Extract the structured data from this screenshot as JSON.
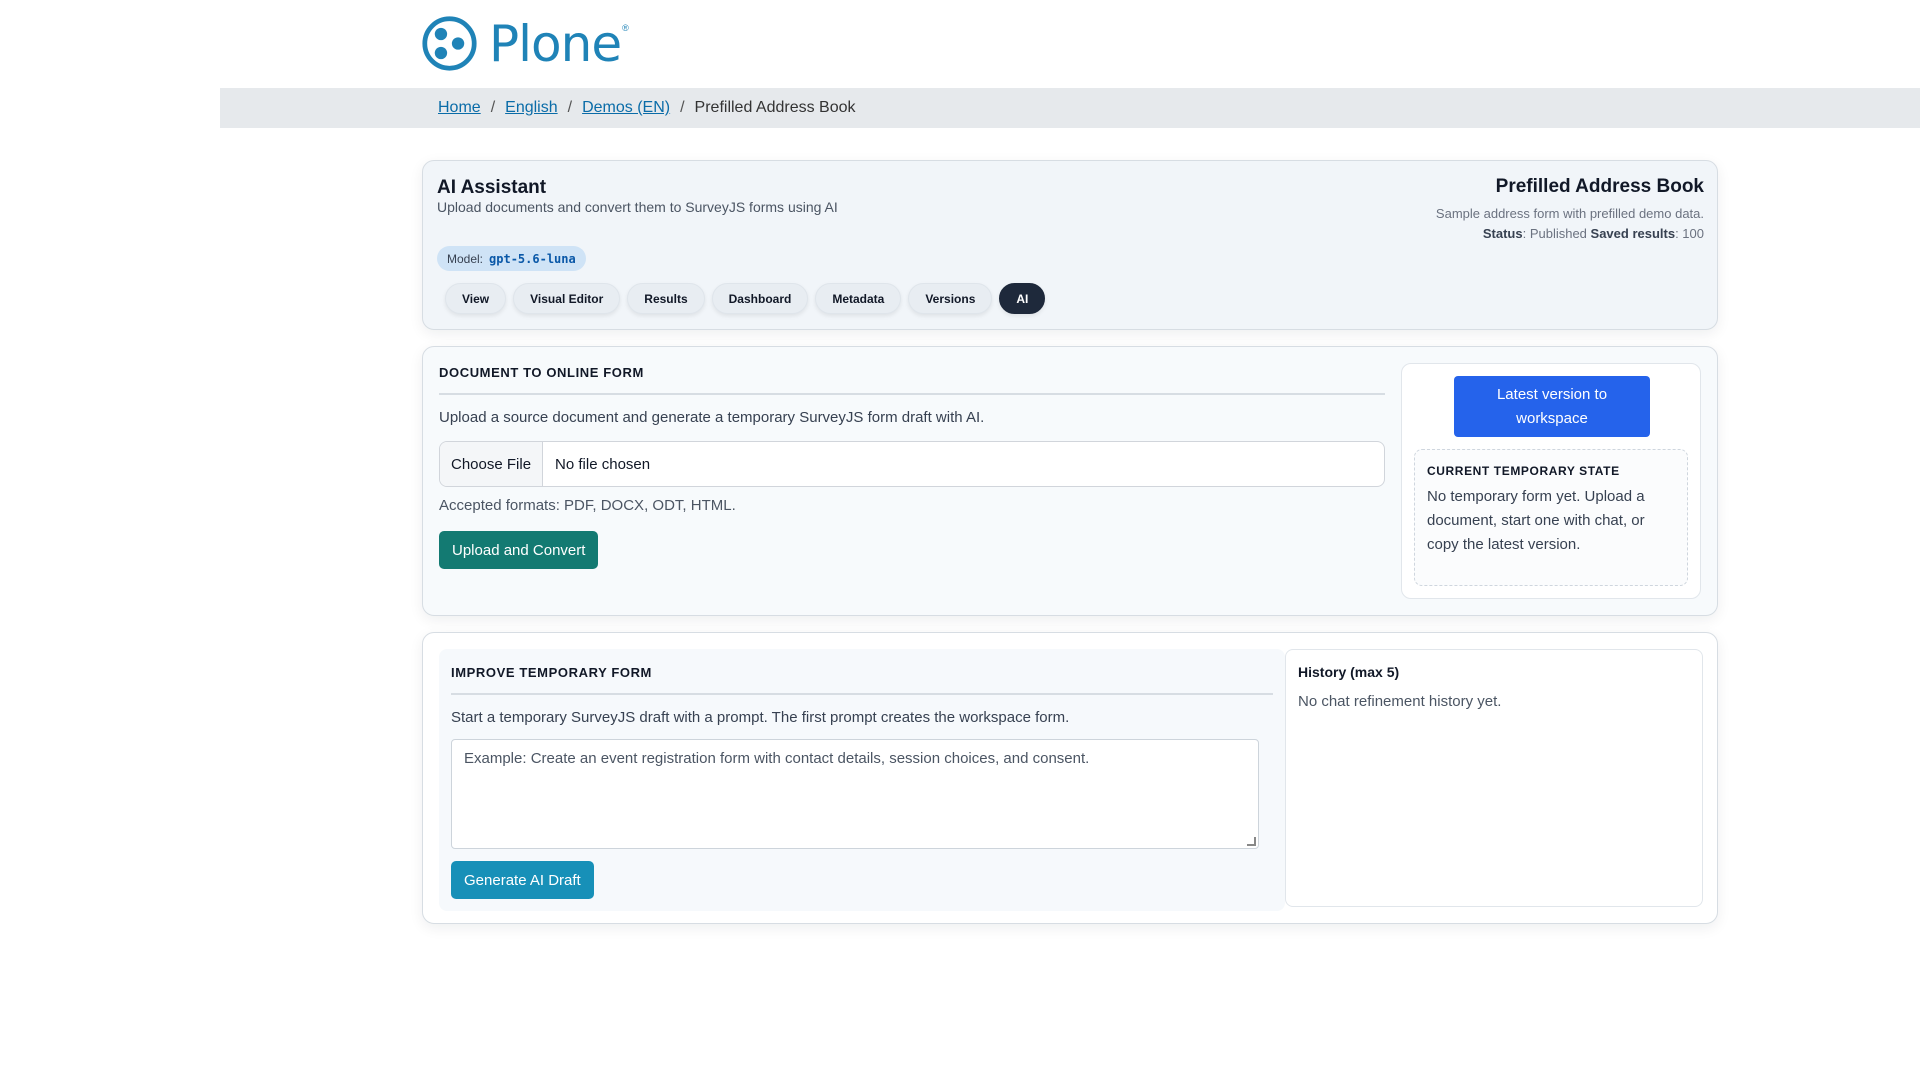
{
  "brand": {
    "name": "Plone",
    "reg": "®",
    "color": "#1f83b7"
  },
  "breadcrumb": {
    "items": [
      {
        "label": "Home"
      },
      {
        "label": "English"
      },
      {
        "label": "Demos (EN)"
      }
    ],
    "current": "Prefilled Address Book",
    "separator": "/"
  },
  "header": {
    "title": "AI Assistant",
    "subtitle": "Upload documents and convert them to SurveyJS forms using AI",
    "model_label": "Model:",
    "model_value": "gpt-5.6-luna",
    "tabs": [
      {
        "label": "View"
      },
      {
        "label": "Visual Editor"
      },
      {
        "label": "Results"
      },
      {
        "label": "Dashboard"
      },
      {
        "label": "Metadata"
      },
      {
        "label": "Versions"
      },
      {
        "label": "AI",
        "active": true
      }
    ],
    "form": {
      "title": "Prefilled Address Book",
      "description": "Sample address form with prefilled demo data.",
      "status_label": "Status",
      "status_value": ": Published ",
      "saved_label": "Saved results",
      "saved_value": ": 100"
    }
  },
  "document_section": {
    "title": "DOCUMENT TO ONLINE FORM",
    "description": "Upload a source document and generate a temporary SurveyJS form draft with AI.",
    "file_button": "Choose File",
    "file_status": "No file chosen",
    "accepted": "Accepted formats: PDF, DOCX, ODT, HTML.",
    "convert_button": "Upload and Convert",
    "latest_button": "Latest version to workspace",
    "temp_state_title": "CURRENT TEMPORARY STATE",
    "temp_state_text": "No temporary form yet. Upload a document, start one with chat, or copy the latest version."
  },
  "improve_section": {
    "title": "IMPROVE TEMPORARY FORM",
    "description": "Start a temporary SurveyJS draft with a prompt. The first prompt creates the workspace form.",
    "prompt_placeholder": "Example: Create an event registration form with contact details, session choices, and consent.",
    "generate_button": "Generate AI Draft",
    "history_title": "History (max 5)",
    "history_empty": "No chat refinement history yet."
  },
  "colors": {
    "convert_button": "#137a72",
    "latest_button": "#2563eb",
    "generate_button": "#1790b8",
    "active_tab": "#1e293b",
    "link": "#0a6ca8"
  }
}
